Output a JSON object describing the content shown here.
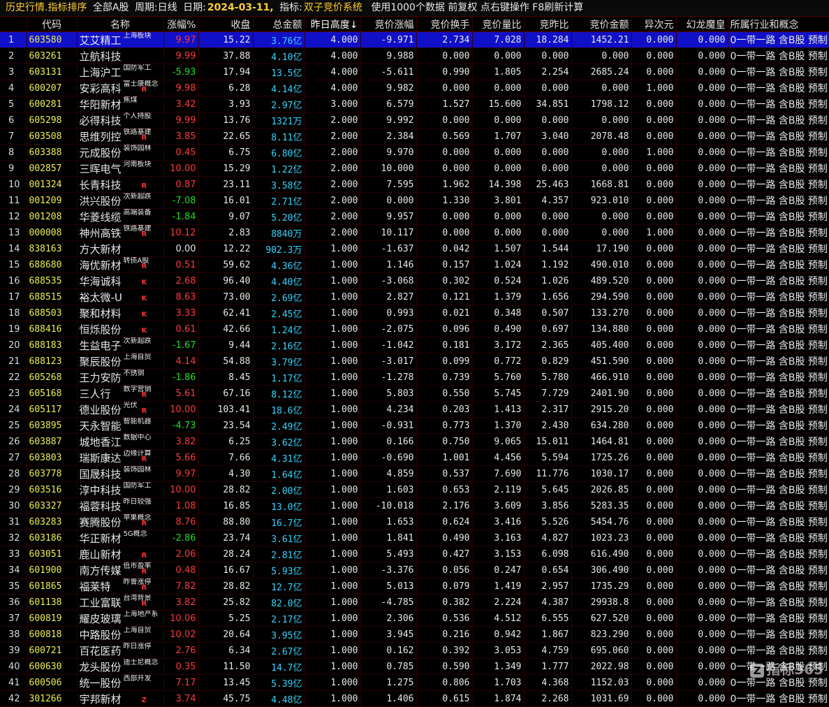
{
  "title_bar": {
    "title": "历史行情.指标排序",
    "board": "全部A股",
    "period_label": "周期:",
    "period": "日线",
    "date_label": "日期:",
    "date": "2024-03-11,",
    "indicator_label": "指标:",
    "indicator": "双子竞价系统",
    "hint": "使用1000个数据 前复权 点右键操作 F8刷新计算"
  },
  "columns": [
    "",
    "代码",
    "名称",
    "涨幅%",
    "收盘",
    "总金额",
    "昨日高度↓",
    "竞价涨幅",
    "竞价换手",
    "竞价量比",
    "竞昨比",
    "竞价金额",
    "异次元",
    "幻龙魔皇",
    "所属行业和概念"
  ],
  "industry_text": "0一带一路 含B股 预制",
  "colors": {
    "selected_row": "#1010c8",
    "up": "#ff3a3a",
    "down": "#22dd22",
    "amount": "#33d6ff",
    "code": "#eeee55"
  },
  "rows": [
    {
      "idx": "1",
      "code": "603580",
      "name": "艾艾精工",
      "tag": "上海板块",
      "mark": "",
      "chg": "9.97",
      "dir": "up",
      "close": "15.22",
      "amt": "3.76亿",
      "h": "4.000",
      "jz": "-9.971",
      "hs": "2.734",
      "lb": "7.028",
      "zb": "18.284",
      "je": "1452.21",
      "yc": "0.000",
      "hl": "0.000"
    },
    {
      "idx": "2",
      "code": "603261",
      "name": "立航科技",
      "tag": "",
      "mark": "",
      "chg": "9.99",
      "dir": "up",
      "close": "37.88",
      "amt": "4.10亿",
      "h": "4.000",
      "jz": "9.988",
      "hs": "0.000",
      "lb": "0.000",
      "zb": "0.000",
      "je": "0.000",
      "yc": "0.000",
      "hl": "0.000"
    },
    {
      "idx": "3",
      "code": "603131",
      "name": "上海沪工",
      "tag": "国防军工",
      "mark": "",
      "chg": "-5.93",
      "dir": "dn",
      "close": "17.94",
      "amt": "13.5亿",
      "h": "4.000",
      "jz": "-5.611",
      "hs": "0.990",
      "lb": "1.805",
      "zb": "2.254",
      "je": "2685.24",
      "yc": "0.000",
      "hl": "0.000"
    },
    {
      "idx": "4",
      "code": "600207",
      "name": "安彩高科",
      "tag": "富士康概念",
      "mark": "R",
      "chg": "9.98",
      "dir": "up",
      "close": "6.28",
      "amt": "4.14亿",
      "h": "4.000",
      "jz": "9.982",
      "hs": "0.000",
      "lb": "0.000",
      "zb": "0.000",
      "je": "0.000",
      "yc": "1.000",
      "hl": "0.000"
    },
    {
      "idx": "5",
      "code": "600281",
      "name": "华阳新材",
      "tag": "焦煤",
      "mark": "",
      "chg": "3.42",
      "dir": "up",
      "close": "3.93",
      "amt": "2.97亿",
      "h": "3.000",
      "jz": "6.579",
      "hs": "1.527",
      "lb": "15.600",
      "zb": "34.851",
      "je": "1798.12",
      "yc": "0.000",
      "hl": "0.000"
    },
    {
      "idx": "6",
      "code": "605298",
      "name": "必得科技",
      "tag": "个人持股",
      "mark": "",
      "chg": "9.99",
      "dir": "up",
      "close": "13.76",
      "amt": "1321万",
      "h": "2.000",
      "jz": "9.992",
      "hs": "0.000",
      "lb": "0.000",
      "zb": "0.000",
      "je": "0.000",
      "yc": "0.000",
      "hl": "0.000"
    },
    {
      "idx": "7",
      "code": "603508",
      "name": "思维列控",
      "tag": "铁路基建",
      "mark": "R",
      "chg": "3.85",
      "dir": "up",
      "close": "22.65",
      "amt": "8.11亿",
      "h": "2.000",
      "jz": "2.384",
      "hs": "0.569",
      "lb": "1.707",
      "zb": "3.040",
      "je": "2078.48",
      "yc": "0.000",
      "hl": "0.000"
    },
    {
      "idx": "8",
      "code": "603388",
      "name": "元成股份",
      "tag": "装饰园林",
      "mark": "",
      "chg": "0.45",
      "dir": "up",
      "close": "6.75",
      "amt": "6.80亿",
      "h": "2.000",
      "jz": "9.970",
      "hs": "0.000",
      "lb": "0.000",
      "zb": "0.000",
      "je": "0.000",
      "yc": "1.000",
      "hl": "0.000"
    },
    {
      "idx": "9",
      "code": "002857",
      "name": "三晖电气",
      "tag": "河南板块",
      "mark": "",
      "chg": "10.00",
      "dir": "up",
      "close": "15.29",
      "amt": "1.22亿",
      "h": "2.000",
      "jz": "10.000",
      "hs": "0.000",
      "lb": "0.000",
      "zb": "0.000",
      "je": "0.000",
      "yc": "0.000",
      "hl": "0.000"
    },
    {
      "idx": "10",
      "code": "001324",
      "name": "长青科技",
      "tag": "",
      "mark": "R",
      "chg": "0.87",
      "dir": "up",
      "close": "23.11",
      "amt": "3.58亿",
      "h": "2.000",
      "jz": "7.595",
      "hs": "1.962",
      "lb": "14.398",
      "zb": "25.463",
      "je": "1668.81",
      "yc": "0.000",
      "hl": "0.000"
    },
    {
      "idx": "11",
      "code": "001209",
      "name": "洪兴股份",
      "tag": "次新超跌",
      "mark": "",
      "chg": "-7.08",
      "dir": "dn",
      "close": "16.01",
      "amt": "2.71亿",
      "h": "2.000",
      "jz": "0.000",
      "hs": "1.330",
      "lb": "3.801",
      "zb": "4.357",
      "je": "923.010",
      "yc": "0.000",
      "hl": "0.000"
    },
    {
      "idx": "12",
      "code": "001208",
      "name": "华菱线缆",
      "tag": "高端装备",
      "mark": "",
      "chg": "-1.84",
      "dir": "dn",
      "close": "9.07",
      "amt": "5.20亿",
      "h": "2.000",
      "jz": "9.957",
      "hs": "0.000",
      "lb": "0.000",
      "zb": "0.000",
      "je": "0.000",
      "yc": "0.000",
      "hl": "0.000"
    },
    {
      "idx": "13",
      "code": "000008",
      "name": "神州高铁",
      "tag": "铁路基建",
      "mark": "R",
      "chg": "10.12",
      "dir": "up",
      "close": "2.83",
      "amt": "8840万",
      "h": "2.000",
      "jz": "10.117",
      "hs": "0.000",
      "lb": "0.000",
      "zb": "0.000",
      "je": "0.000",
      "yc": "1.000",
      "hl": "0.000"
    },
    {
      "idx": "14",
      "code": "838163",
      "name": "方大新材",
      "tag": "",
      "mark": "",
      "chg": "0.00",
      "dir": "zero",
      "close": "12.22",
      "amt": "902.3万",
      "h": "1.000",
      "jz": "-1.637",
      "hs": "0.042",
      "lb": "1.507",
      "zb": "1.544",
      "je": "17.190",
      "yc": "0.000",
      "hl": "0.000"
    },
    {
      "idx": "15",
      "code": "688680",
      "name": "海优新材",
      "tag": "转债A股",
      "mark": "R",
      "chg": "0.51",
      "dir": "up",
      "close": "59.62",
      "amt": "4.36亿",
      "h": "1.000",
      "jz": "1.146",
      "hs": "0.157",
      "lb": "1.024",
      "zb": "1.192",
      "je": "490.010",
      "yc": "0.000",
      "hl": "0.000"
    },
    {
      "idx": "16",
      "code": "688535",
      "name": "华海诚科",
      "tag": "",
      "mark": "K",
      "chg": "2.68",
      "dir": "up",
      "close": "96.40",
      "amt": "4.40亿",
      "h": "1.000",
      "jz": "-3.068",
      "hs": "0.302",
      "lb": "0.524",
      "zb": "1.026",
      "je": "489.520",
      "yc": "0.000",
      "hl": "0.000"
    },
    {
      "idx": "17",
      "code": "688515",
      "name": "裕太微-U",
      "tag": "",
      "mark": "K",
      "chg": "8.63",
      "dir": "up",
      "close": "73.00",
      "amt": "2.69亿",
      "h": "1.000",
      "jz": "2.827",
      "hs": "0.121",
      "lb": "1.379",
      "zb": "1.656",
      "je": "294.590",
      "yc": "0.000",
      "hl": "0.000"
    },
    {
      "idx": "18",
      "code": "688503",
      "name": "聚和材料",
      "tag": "",
      "mark": "K",
      "chg": "3.33",
      "dir": "up",
      "close": "62.41",
      "amt": "2.45亿",
      "h": "1.000",
      "jz": "0.993",
      "hs": "0.021",
      "lb": "0.348",
      "zb": "0.507",
      "je": "133.270",
      "yc": "0.000",
      "hl": "0.000"
    },
    {
      "idx": "19",
      "code": "688416",
      "name": "恒烁股份",
      "tag": "",
      "mark": "K",
      "chg": "0.61",
      "dir": "up",
      "close": "42.66",
      "amt": "1.24亿",
      "h": "1.000",
      "jz": "-2.075",
      "hs": "0.096",
      "lb": "0.490",
      "zb": "0.697",
      "je": "134.880",
      "yc": "0.000",
      "hl": "0.000"
    },
    {
      "idx": "20",
      "code": "688183",
      "name": "生益电子",
      "tag": "次新超跌",
      "mark": "",
      "chg": "-1.67",
      "dir": "dn",
      "close": "9.44",
      "amt": "2.16亿",
      "h": "1.000",
      "jz": "-1.042",
      "hs": "0.181",
      "lb": "3.172",
      "zb": "2.365",
      "je": "405.400",
      "yc": "0.000",
      "hl": "0.000"
    },
    {
      "idx": "21",
      "code": "688123",
      "name": "聚辰股份",
      "tag": "上海自贸",
      "mark": "",
      "chg": "4.14",
      "dir": "up",
      "close": "54.88",
      "amt": "3.79亿",
      "h": "1.000",
      "jz": "-3.017",
      "hs": "0.099",
      "lb": "0.772",
      "zb": "0.829",
      "je": "451.590",
      "yc": "0.000",
      "hl": "0.000"
    },
    {
      "idx": "22",
      "code": "605268",
      "name": "王力安防",
      "tag": "不锈钢",
      "mark": "",
      "chg": "-1.86",
      "dir": "dn",
      "close": "8.45",
      "amt": "1.17亿",
      "h": "1.000",
      "jz": "-1.278",
      "hs": "0.739",
      "lb": "5.760",
      "zb": "5.780",
      "je": "466.910",
      "yc": "0.000",
      "hl": "0.000"
    },
    {
      "idx": "23",
      "code": "605168",
      "name": "三人行",
      "tag": "数字营销",
      "mark": "R",
      "chg": "5.61",
      "dir": "up",
      "close": "67.16",
      "amt": "8.12亿",
      "h": "1.000",
      "jz": "5.803",
      "hs": "0.550",
      "lb": "5.745",
      "zb": "7.729",
      "je": "2401.90",
      "yc": "0.000",
      "hl": "0.000"
    },
    {
      "idx": "24",
      "code": "605117",
      "name": "德业股份",
      "tag": "光伏",
      "mark": "R",
      "chg": "10.00",
      "dir": "up",
      "close": "103.41",
      "amt": "18.6亿",
      "h": "1.000",
      "jz": "4.234",
      "hs": "0.203",
      "lb": "1.413",
      "zb": "2.317",
      "je": "2915.20",
      "yc": "0.000",
      "hl": "0.000"
    },
    {
      "idx": "25",
      "code": "603895",
      "name": "天永智能",
      "tag": "智能机器",
      "mark": "",
      "chg": "-4.73",
      "dir": "dn",
      "close": "23.54",
      "amt": "2.49亿",
      "h": "1.000",
      "jz": "-0.931",
      "hs": "0.773",
      "lb": "1.370",
      "zb": "2.430",
      "je": "634.280",
      "yc": "0.000",
      "hl": "0.000"
    },
    {
      "idx": "26",
      "code": "603887",
      "name": "城地香江",
      "tag": "数据中心",
      "mark": "",
      "chg": "3.82",
      "dir": "up",
      "close": "6.25",
      "amt": "3.62亿",
      "h": "1.000",
      "jz": "0.166",
      "hs": "0.750",
      "lb": "9.065",
      "zb": "15.011",
      "je": "1464.81",
      "yc": "0.000",
      "hl": "0.000"
    },
    {
      "idx": "27",
      "code": "603803",
      "name": "瑞斯康达",
      "tag": "边缘计算",
      "mark": "R",
      "chg": "5.66",
      "dir": "up",
      "close": "7.66",
      "amt": "4.31亿",
      "h": "1.000",
      "jz": "-0.690",
      "hs": "1.001",
      "lb": "4.456",
      "zb": "5.594",
      "je": "1725.26",
      "yc": "0.000",
      "hl": "0.000"
    },
    {
      "idx": "28",
      "code": "603778",
      "name": "国晟科技",
      "tag": "装饰园林",
      "mark": "",
      "chg": "9.97",
      "dir": "up",
      "close": "4.30",
      "amt": "1.64亿",
      "h": "1.000",
      "jz": "4.859",
      "hs": "0.537",
      "lb": "7.690",
      "zb": "11.776",
      "je": "1030.17",
      "yc": "0.000",
      "hl": "0.000"
    },
    {
      "idx": "29",
      "code": "603516",
      "name": "淳中科技",
      "tag": "国防军工",
      "mark": "",
      "chg": "10.00",
      "dir": "up",
      "close": "28.82",
      "amt": "2.00亿",
      "h": "1.000",
      "jz": "1.603",
      "hs": "0.653",
      "lb": "2.119",
      "zb": "5.645",
      "je": "2026.85",
      "yc": "0.000",
      "hl": "0.000"
    },
    {
      "idx": "30",
      "code": "603327",
      "name": "福蓉科技",
      "tag": "昨日较强",
      "mark": "",
      "chg": "1.08",
      "dir": "up",
      "close": "16.85",
      "amt": "13.0亿",
      "h": "1.000",
      "jz": "-10.018",
      "hs": "2.176",
      "lb": "3.609",
      "zb": "3.856",
      "je": "5283.35",
      "yc": "0.000",
      "hl": "0.000"
    },
    {
      "idx": "31",
      "code": "603283",
      "name": "赛腾股份",
      "tag": "苹果概念",
      "mark": "R",
      "chg": "8.76",
      "dir": "up",
      "close": "88.80",
      "amt": "16.7亿",
      "h": "1.000",
      "jz": "1.653",
      "hs": "0.624",
      "lb": "3.416",
      "zb": "5.526",
      "je": "5454.76",
      "yc": "0.000",
      "hl": "0.000"
    },
    {
      "idx": "32",
      "code": "603186",
      "name": "华正新材",
      "tag": "5G概念",
      "mark": "",
      "chg": "-2.86",
      "dir": "dn",
      "close": "23.74",
      "amt": "3.61亿",
      "h": "1.000",
      "jz": "1.841",
      "hs": "0.490",
      "lb": "3.163",
      "zb": "4.827",
      "je": "1023.23",
      "yc": "0.000",
      "hl": "0.000"
    },
    {
      "idx": "33",
      "code": "603051",
      "name": "鹿山新材",
      "tag": "",
      "mark": "R",
      "chg": "2.06",
      "dir": "up",
      "close": "28.24",
      "amt": "2.81亿",
      "h": "1.000",
      "jz": "5.493",
      "hs": "0.427",
      "lb": "3.153",
      "zb": "6.098",
      "je": "616.490",
      "yc": "0.000",
      "hl": "0.000"
    },
    {
      "idx": "34",
      "code": "601900",
      "name": "南方传媒",
      "tag": "低市盈率",
      "mark": "R",
      "chg": "0.48",
      "dir": "up",
      "close": "16.67",
      "amt": "5.93亿",
      "h": "1.000",
      "jz": "-3.376",
      "hs": "0.056",
      "lb": "0.247",
      "zb": "0.654",
      "je": "306.490",
      "yc": "0.000",
      "hl": "0.000"
    },
    {
      "idx": "35",
      "code": "601865",
      "name": "福莱特",
      "tag": "昨曾涨停",
      "mark": "R",
      "chg": "7.82",
      "dir": "up",
      "close": "28.82",
      "amt": "12.7亿",
      "h": "1.000",
      "jz": "5.013",
      "hs": "0.079",
      "lb": "1.419",
      "zb": "2.957",
      "je": "1735.29",
      "yc": "0.000",
      "hl": "0.000"
    },
    {
      "idx": "36",
      "code": "601138",
      "name": "工业富联",
      "tag": "台湾背景",
      "mark": "R",
      "chg": "3.82",
      "dir": "up",
      "close": "25.82",
      "amt": "82.0亿",
      "h": "1.000",
      "jz": "-4.785",
      "hs": "0.382",
      "lb": "2.224",
      "zb": "4.387",
      "je": "29938.8",
      "yc": "0.000",
      "hl": "0.000"
    },
    {
      "idx": "37",
      "code": "600819",
      "name": "耀皮玻璃",
      "tag": "上海地产系",
      "mark": "",
      "chg": "10.06",
      "dir": "up",
      "close": "5.25",
      "amt": "2.17亿",
      "h": "1.000",
      "jz": "2.306",
      "hs": "0.536",
      "lb": "4.512",
      "zb": "6.555",
      "je": "627.520",
      "yc": "0.000",
      "hl": "0.000"
    },
    {
      "idx": "38",
      "code": "600818",
      "name": "中路股份",
      "tag": "上海自贸",
      "mark": "",
      "chg": "10.02",
      "dir": "up",
      "close": "20.64",
      "amt": "3.95亿",
      "h": "1.000",
      "jz": "3.945",
      "hs": "0.216",
      "lb": "0.942",
      "zb": "1.867",
      "je": "823.290",
      "yc": "0.000",
      "hl": "0.000"
    },
    {
      "idx": "39",
      "code": "600721",
      "name": "百花医药",
      "tag": "昨日涨停",
      "mark": "",
      "chg": "2.76",
      "dir": "up",
      "close": "6.34",
      "amt": "2.67亿",
      "h": "1.000",
      "jz": "0.162",
      "hs": "0.392",
      "lb": "3.053",
      "zb": "4.759",
      "je": "695.060",
      "yc": "0.000",
      "hl": "0.000"
    },
    {
      "idx": "40",
      "code": "600630",
      "name": "龙头股份",
      "tag": "迪士尼概念",
      "mark": "",
      "chg": "0.35",
      "dir": "up",
      "close": "11.50",
      "amt": "14.7亿",
      "h": "1.000",
      "jz": "0.785",
      "hs": "0.590",
      "lb": "1.349",
      "zb": "1.777",
      "je": "2022.98",
      "yc": "0.000",
      "hl": "0.000"
    },
    {
      "idx": "41",
      "code": "600506",
      "name": "统一股份",
      "tag": "西部开发",
      "mark": "",
      "chg": "7.17",
      "dir": "up",
      "close": "13.45",
      "amt": "5.39亿",
      "h": "1.000",
      "jz": "1.275",
      "hs": "0.806",
      "lb": "1.703",
      "zb": "4.368",
      "je": "1152.03",
      "yc": "0.000",
      "hl": "0.000"
    },
    {
      "idx": "42",
      "code": "301266",
      "name": "宇邦新材",
      "tag": "",
      "mark": "Z",
      "chg": "3.74",
      "dir": "up",
      "close": "45.75",
      "amt": "4.48亿",
      "h": "1.000",
      "jz": "1.406",
      "hs": "0.615",
      "lb": "1.874",
      "zb": "2.268",
      "je": "1031.69",
      "yc": "0.000",
      "hl": "0.000"
    }
  ],
  "watermark": {
    "logo": "Z",
    "text": "指标365"
  }
}
